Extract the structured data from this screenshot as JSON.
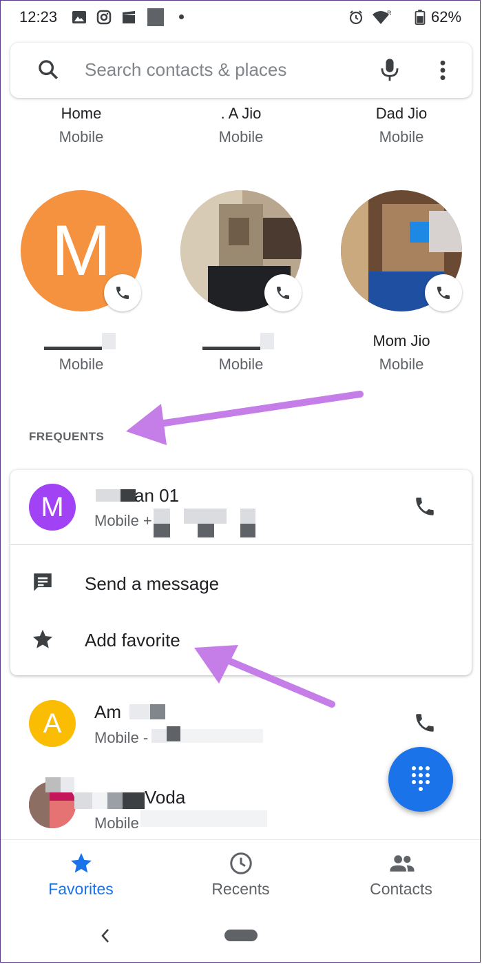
{
  "status_bar": {
    "time": "12:23",
    "battery": "62%",
    "icons": [
      "gallery-icon",
      "instagram-icon",
      "clapper-icon",
      "square-icon",
      "dot-icon",
      "alarm-icon",
      "wifi-icon",
      "battery-icon"
    ]
  },
  "search": {
    "placeholder": "Search contacts & places",
    "icons": [
      "search-icon",
      "mic-icon",
      "more-vert-icon"
    ]
  },
  "favorites_top": [
    {
      "name": "Home",
      "type": "Mobile"
    },
    {
      "name": ". A Jio",
      "type": "Mobile"
    },
    {
      "name": "Dad Jio",
      "type": "Mobile"
    }
  ],
  "favorites_bottom": [
    {
      "initial": "M",
      "name": "",
      "type": "Mobile",
      "color": "#f4923f"
    },
    {
      "name": "",
      "type": "Mobile"
    },
    {
      "name": "Mom Jio",
      "type": "Mobile"
    }
  ],
  "frequents": {
    "label": "FREQUENTS",
    "expanded": {
      "initial": "M",
      "name": "an 01",
      "sub": "Mobile +",
      "avatar_color": "#a142f4",
      "actions": [
        {
          "label": "Send a message",
          "icon": "message-icon"
        },
        {
          "label": "Add favorite",
          "icon": "star-icon"
        }
      ]
    },
    "items": [
      {
        "initial": "A",
        "name": "Am",
        "sub": "Mobile -",
        "avatar_color": "#fbbc04"
      },
      {
        "name": "Voda",
        "sub": "Mobile"
      }
    ]
  },
  "bottom_nav": {
    "items": [
      {
        "label": "Favorites",
        "icon": "star-icon",
        "active": true
      },
      {
        "label": "Recents",
        "icon": "clock-icon",
        "active": false
      },
      {
        "label": "Contacts",
        "icon": "people-icon",
        "active": false
      }
    ],
    "active_color": "#1a73e8",
    "inactive_color": "#5f6368"
  },
  "colors": {
    "fab": "#1a73e8",
    "annotation_arrow": "#c57ee8"
  }
}
